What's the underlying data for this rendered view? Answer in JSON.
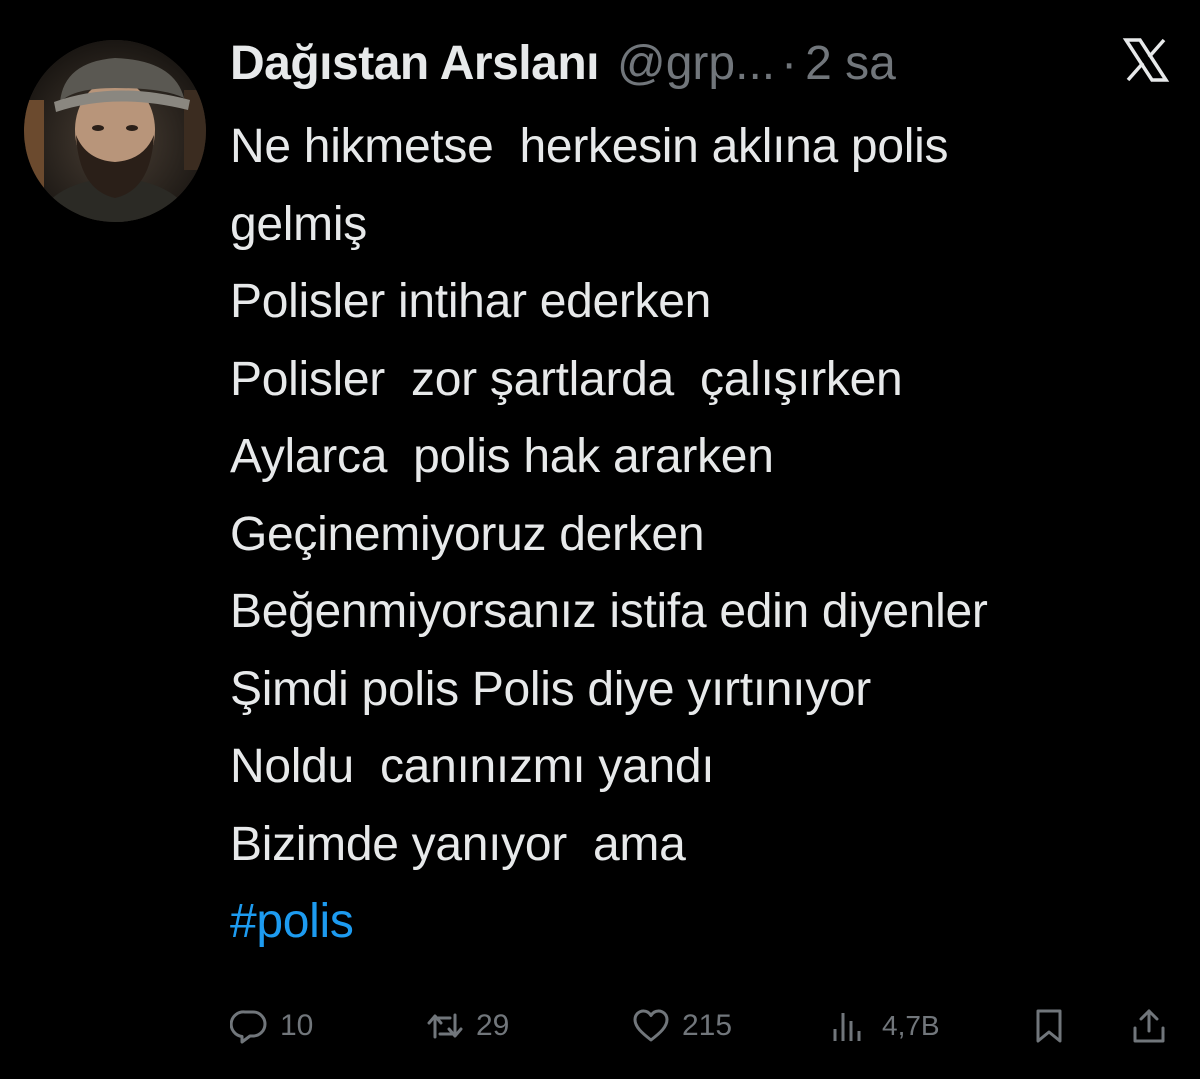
{
  "tweet": {
    "display_name": "Dağıstan Arslanı",
    "handle": "@grp...",
    "separator": "·",
    "time": "2 sa",
    "lines": [
      "Ne hikmetse  herkesin aklına polis",
      "gelmiş",
      "Polisler intihar ederken",
      "Polisler  zor şartlarda  çalışırken",
      "Aylarca  polis hak ararken",
      "Geçinemiyoruz derken",
      "Beğenmiyorsanız istifa edin diyenler",
      "Şimdi polis Polis diye yırtınıyor",
      "Noldu  canınızmı yandı",
      "Bizimde yanıyor  ama"
    ],
    "hashtag": "#polis"
  },
  "actions": {
    "replies": "10",
    "retweets": "29",
    "likes": "215",
    "views": "4,7B"
  },
  "icons": {
    "avatar": "avatar",
    "brand": "x-logo-icon",
    "reply": "reply-icon",
    "retweet": "retweet-icon",
    "like": "heart-icon",
    "views": "views-chart-icon",
    "bookmark": "bookmark-icon",
    "share": "share-icon"
  },
  "colors": {
    "background": "#000000",
    "text": "#e7e9ea",
    "muted": "#71767b",
    "link": "#1d9bf0"
  }
}
